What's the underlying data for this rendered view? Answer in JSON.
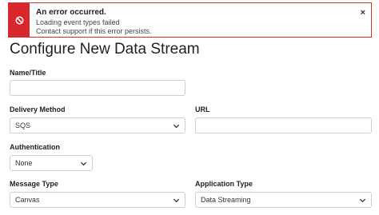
{
  "alert": {
    "title": "An error occurred.",
    "line1": "Loading event types failed",
    "line2": "Contact support if this error persists.",
    "close": "×",
    "accent_color": "#d9252c",
    "icon": "blocked-icon"
  },
  "page": {
    "title": "Configure New Data Stream"
  },
  "form": {
    "name": {
      "label": "Name/Title",
      "value": ""
    },
    "delivery_method": {
      "label": "Delivery Method",
      "value": "SQS"
    },
    "url": {
      "label": "URL",
      "value": ""
    },
    "authentication": {
      "label": "Authentication",
      "value": "None"
    },
    "message_type": {
      "label": "Message Type",
      "value": "Canvas"
    },
    "application_type": {
      "label": "Application Type",
      "value": "Data Streaming"
    }
  }
}
